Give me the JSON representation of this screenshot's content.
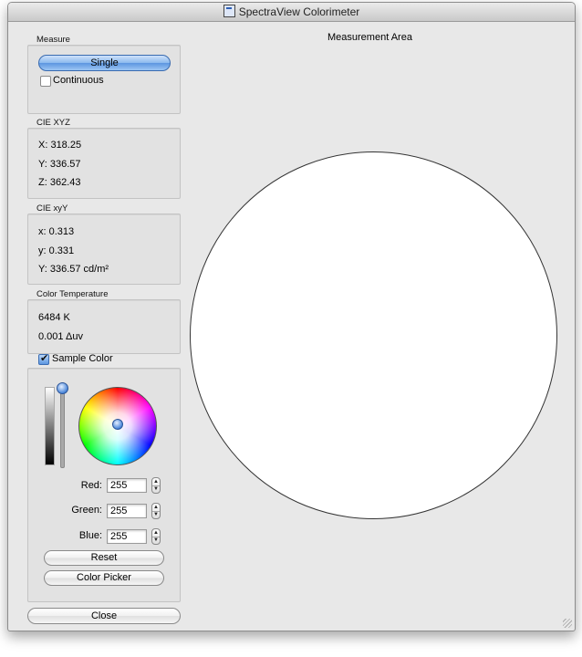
{
  "window": {
    "title": "SpectraView Colorimeter"
  },
  "measure": {
    "label": "Measure",
    "single_button": "Single",
    "continuous_label": "Continuous",
    "continuous_checked": false
  },
  "cie_xyz": {
    "label": "CIE XYZ",
    "x": "X: 318.25",
    "y": "Y: 336.57",
    "z": "Z: 362.43"
  },
  "cie_xyy": {
    "label": "CIE xyY",
    "x": "x: 0.313",
    "y": "y: 0.331",
    "Y": "Y: 336.57 cd/m²"
  },
  "color_temperature": {
    "label": "Color Temperature",
    "kelvin": "6484 K",
    "duv": "0.001 Δuv"
  },
  "sample": {
    "label": "Sample Color",
    "checked": true,
    "red_label": "Red:",
    "red_value": "255",
    "green_label": "Green:",
    "green_value": "255",
    "blue_label": "Blue:",
    "blue_value": "255",
    "reset_button": "Reset",
    "picker_button": "Color Picker"
  },
  "measurement_area": {
    "title": "Measurement Area",
    "color": "#ffffff"
  },
  "close_button": "Close"
}
